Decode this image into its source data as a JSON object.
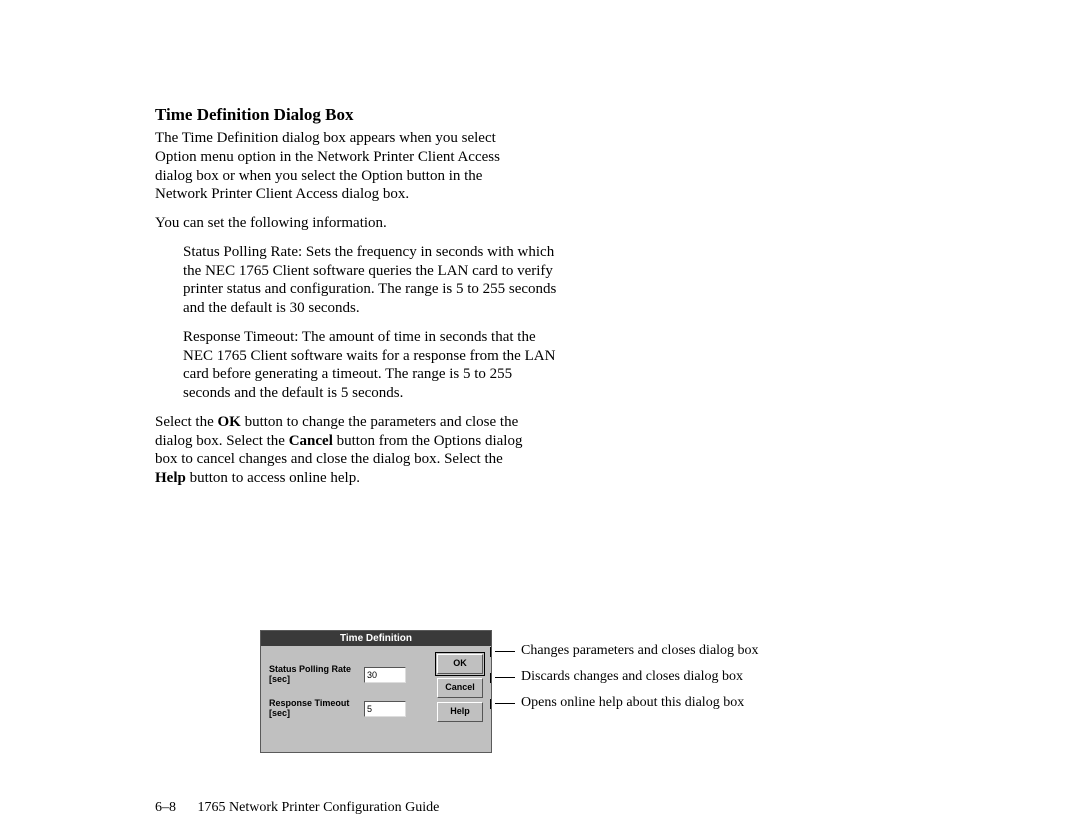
{
  "heading": "Time Definition Dialog Box",
  "para1": "The Time Definition dialog box appears when you select Option menu option in the Network Printer Client Access dialog box or when you select the Option button in the Network Printer Client Access dialog box.",
  "para2": "You can set the following information.",
  "bullet1": "Status Polling Rate:  Sets the frequency in seconds with which the NEC 1765 Client software queries the LAN card to verify printer status and configuration. The range is 5 to 255 seconds and the default is 30 seconds.",
  "bullet2": "Response Timeout:  The amount of time in seconds that the NEC 1765 Client software waits for a response from the LAN card before generating a timeout. The range is 5 to 255 seconds and the default is 5 seconds.",
  "para3_a": "Select the ",
  "para3_ok": "OK",
  "para3_b": " button to change the parameters and close the dialog box. Select the ",
  "para3_cancel": "Cancel",
  "para3_c": " button from the Options dialog box to cancel changes and close the dialog box. Select the ",
  "para3_help": "Help",
  "para3_d": " button to access online help.",
  "dialog": {
    "title": "Time Definition",
    "field1_label": "Status Polling Rate [sec]",
    "field1_value": "30",
    "field2_label": "Response Timeout [sec]",
    "field2_value": "5",
    "btn_ok": "OK",
    "btn_cancel": "Cancel",
    "btn_help": "Help"
  },
  "callouts": {
    "ok": "Changes parameters and closes dialog box",
    "cancel": "Discards changes and closes dialog box",
    "help": "Opens online help about this dialog box"
  },
  "footer": {
    "page": "6–8",
    "title": "1765 Network Printer Configuration Guide"
  }
}
